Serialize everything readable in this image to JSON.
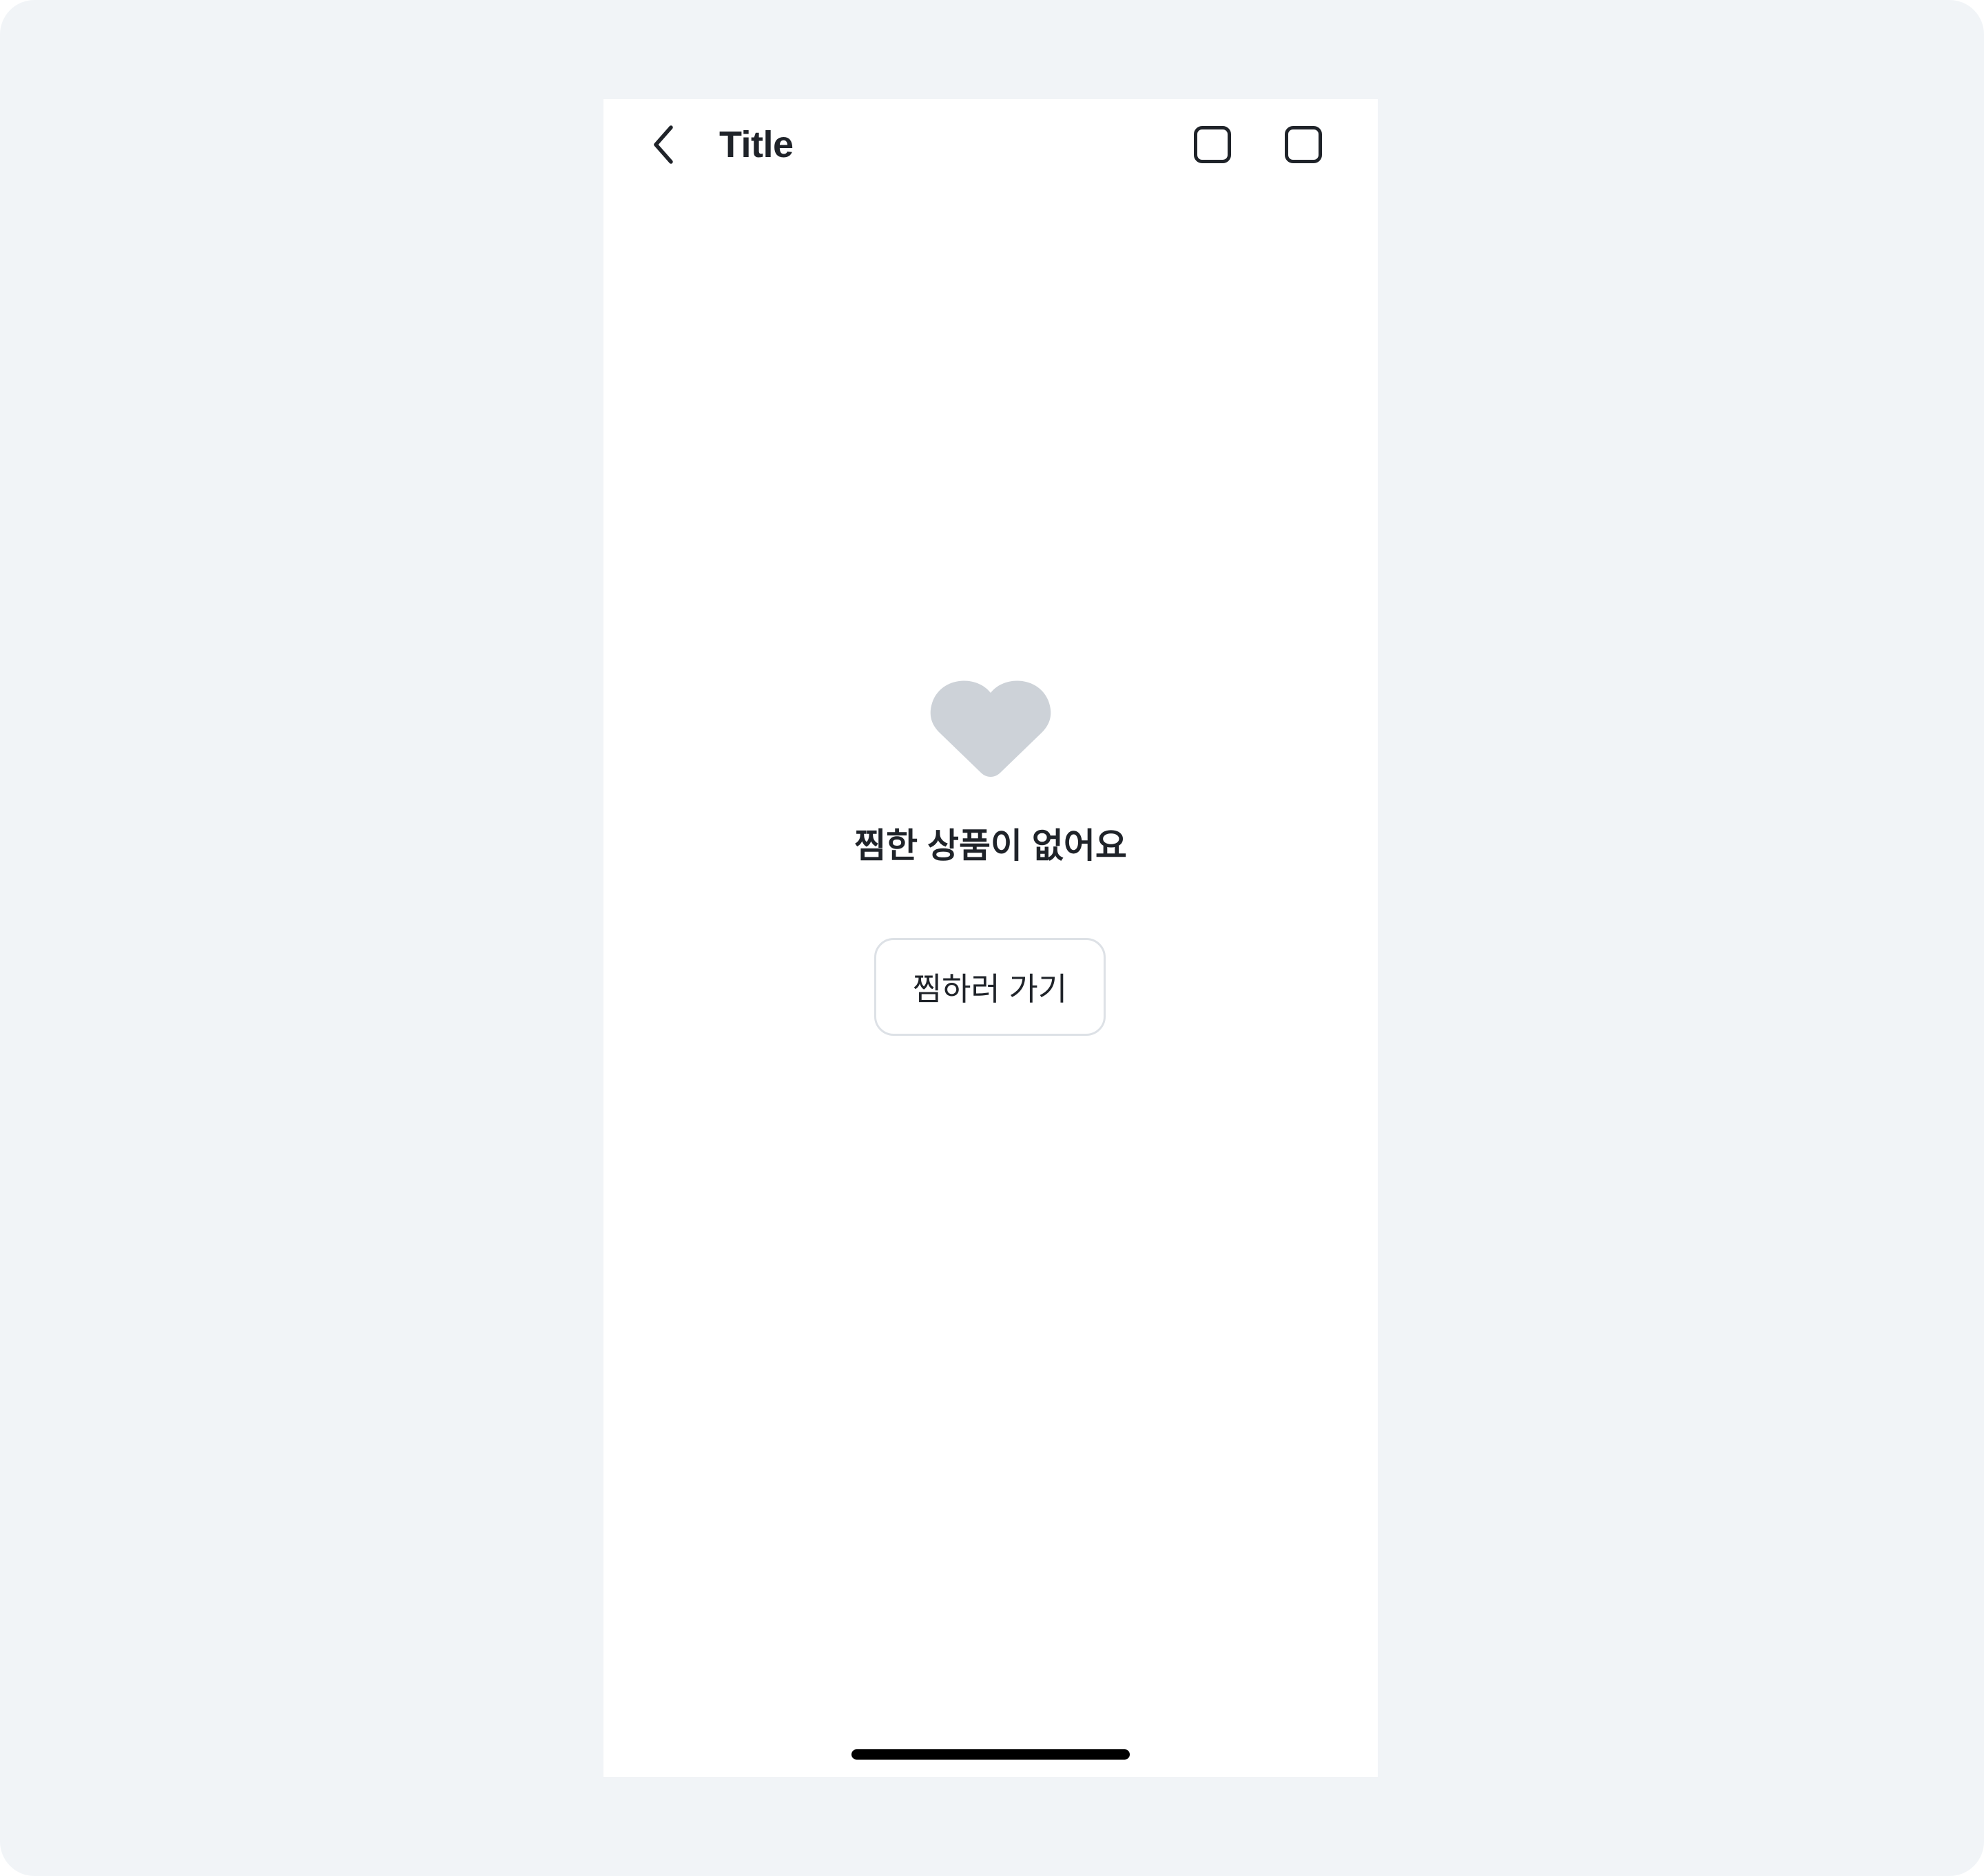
{
  "header": {
    "title": "Title",
    "back_icon": "chevron-left-icon",
    "actions": [
      {
        "icon": "square-icon"
      },
      {
        "icon": "square-icon"
      }
    ]
  },
  "empty_state": {
    "icon": "heart-icon",
    "message": "찜한 상품이 없어요",
    "button_label": "찜하러 가기"
  },
  "colors": {
    "background": "#f1f4f7",
    "screen": "#ffffff",
    "text": "#1f2329",
    "heart": "#cdd2d8",
    "button_border": "#dde1e6"
  }
}
